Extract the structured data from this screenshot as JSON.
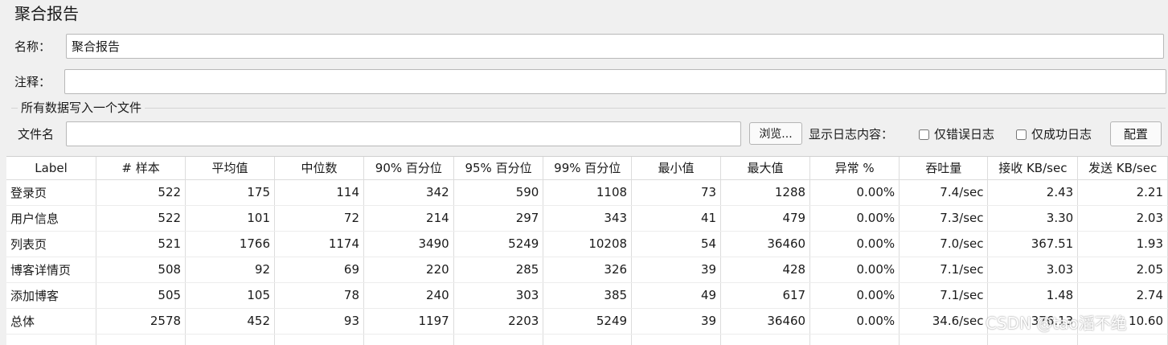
{
  "page": {
    "title": "聚合报告"
  },
  "form": {
    "name_label": "名称：",
    "name_value": "聚合报告",
    "comment_label": "注释：",
    "comment_value": ""
  },
  "file_group": {
    "title": "所有数据写入一个文件",
    "filename_label": "文件名",
    "filename_value": "",
    "browse_label": "浏览...",
    "log_label": "显示日志内容：",
    "errors_only_label": "仅错误日志",
    "errors_only_checked": false,
    "success_only_label": "仅成功日志",
    "success_only_checked": false,
    "config_label": "配置"
  },
  "table": {
    "columns": [
      "Label",
      "# 样本",
      "平均值",
      "中位数",
      "90% 百分位",
      "95% 百分位",
      "99% 百分位",
      "最小值",
      "最大值",
      "异常 %",
      "吞吐量",
      "接收 KB/sec",
      "发送 KB/sec"
    ],
    "rows": [
      [
        "登录页",
        "522",
        "175",
        "114",
        "342",
        "590",
        "1108",
        "73",
        "1288",
        "0.00%",
        "7.4/sec",
        "2.43",
        "2.21"
      ],
      [
        "用户信息",
        "522",
        "101",
        "72",
        "214",
        "297",
        "343",
        "41",
        "479",
        "0.00%",
        "7.3/sec",
        "3.30",
        "2.03"
      ],
      [
        "列表页",
        "521",
        "1766",
        "1174",
        "3490",
        "5249",
        "10208",
        "54",
        "36460",
        "0.00%",
        "7.0/sec",
        "367.51",
        "1.93"
      ],
      [
        "博客详情页",
        "508",
        "92",
        "69",
        "220",
        "285",
        "326",
        "39",
        "428",
        "0.00%",
        "7.1/sec",
        "3.03",
        "2.05"
      ],
      [
        "添加博客",
        "505",
        "105",
        "78",
        "240",
        "303",
        "385",
        "49",
        "617",
        "0.00%",
        "7.1/sec",
        "1.48",
        "2.74"
      ],
      [
        "总体",
        "2578",
        "452",
        "93",
        "1197",
        "2203",
        "5249",
        "39",
        "36460",
        "0.00%",
        "34.6/sec",
        "376.13",
        "10.60"
      ]
    ]
  },
  "watermark": "CSDN @tao滔不绝"
}
